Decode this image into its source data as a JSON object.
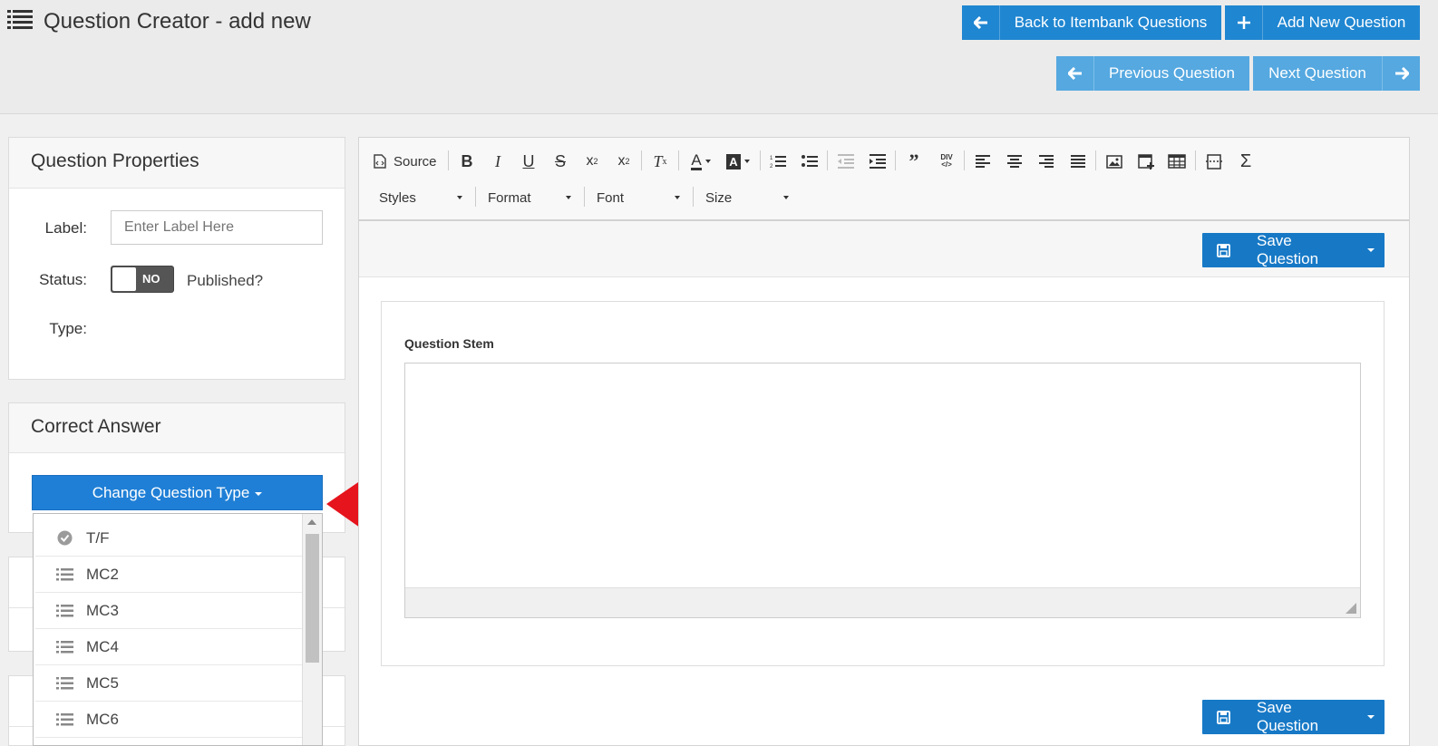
{
  "header": {
    "title": "Question Creator - add new",
    "back_label": "Back to Itembank Questions",
    "add_label": "Add New Question",
    "prev_label": "Previous Question",
    "next_label": "Next Question"
  },
  "properties": {
    "heading": "Question Properties",
    "label_label": "Label:",
    "label_placeholder": "Enter Label Here",
    "status_label": "Status:",
    "toggle_text": "NO",
    "published_label": "Published?",
    "type_label": "Type:"
  },
  "correct_answer": {
    "heading": "Correct Answer",
    "change_type_label": "Change Question Type",
    "options": [
      {
        "label": "T/F",
        "icon": "check-circle-icon"
      },
      {
        "label": "MC2",
        "icon": "list-icon"
      },
      {
        "label": "MC3",
        "icon": "list-icon"
      },
      {
        "label": "MC4",
        "icon": "list-icon"
      },
      {
        "label": "MC5",
        "icon": "list-icon"
      },
      {
        "label": "MC6",
        "icon": "list-icon"
      }
    ]
  },
  "editor": {
    "source_label": "Source",
    "combos": [
      "Styles",
      "Format",
      "Font",
      "Size"
    ],
    "save_label": "Save Question",
    "stem_label": "Question Stem"
  },
  "colors": {
    "primary": "#1f86d1",
    "light_primary": "#55a8e0",
    "arrow": "#e5141d"
  }
}
